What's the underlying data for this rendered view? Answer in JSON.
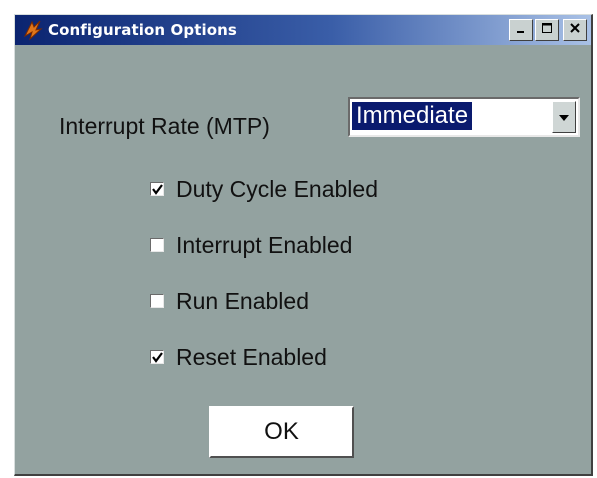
{
  "window": {
    "title": "Configuration Options",
    "controls": [
      "minimize-icon",
      "maximize-icon",
      "close-icon"
    ]
  },
  "interrupt_rate": {
    "label": "Interrupt Rate (MTP)",
    "selected": "Immediate"
  },
  "checkboxes": [
    {
      "label": "Duty Cycle Enabled",
      "checked": true
    },
    {
      "label": "Interrupt Enabled",
      "checked": false
    },
    {
      "label": "Run Enabled",
      "checked": false
    },
    {
      "label": "Reset Enabled",
      "checked": true
    }
  ],
  "ok_label": "OK",
  "colors": {
    "dialog_background": "#93a2a0",
    "titlebar_start": "#0b2470",
    "titlebar_end": "#a9c1e6",
    "selection_highlight": "#0a1a6e"
  }
}
